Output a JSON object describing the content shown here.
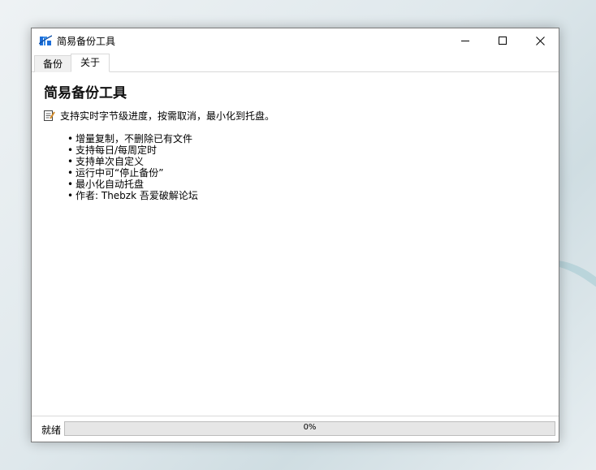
{
  "window": {
    "title": "简易备份工具"
  },
  "tabs": [
    {
      "label": "备份"
    },
    {
      "label": "关于"
    }
  ],
  "about": {
    "heading": "简易备份工具",
    "intro": "支持实时字节级进度，按需取消，最小化到托盘。",
    "features": [
      "增量复制，不删除已有文件",
      "支持每日/每周定时",
      "支持单次自定义",
      "运行中可“停止备份”",
      "最小化自动托盘",
      "作者: Thebzk 吾爱破解论坛"
    ]
  },
  "status": {
    "label": "就绪",
    "progress_text": "0%",
    "progress": 0
  },
  "colors": {
    "progress_fill": "#06b025",
    "accent": "#1e6fd9"
  }
}
